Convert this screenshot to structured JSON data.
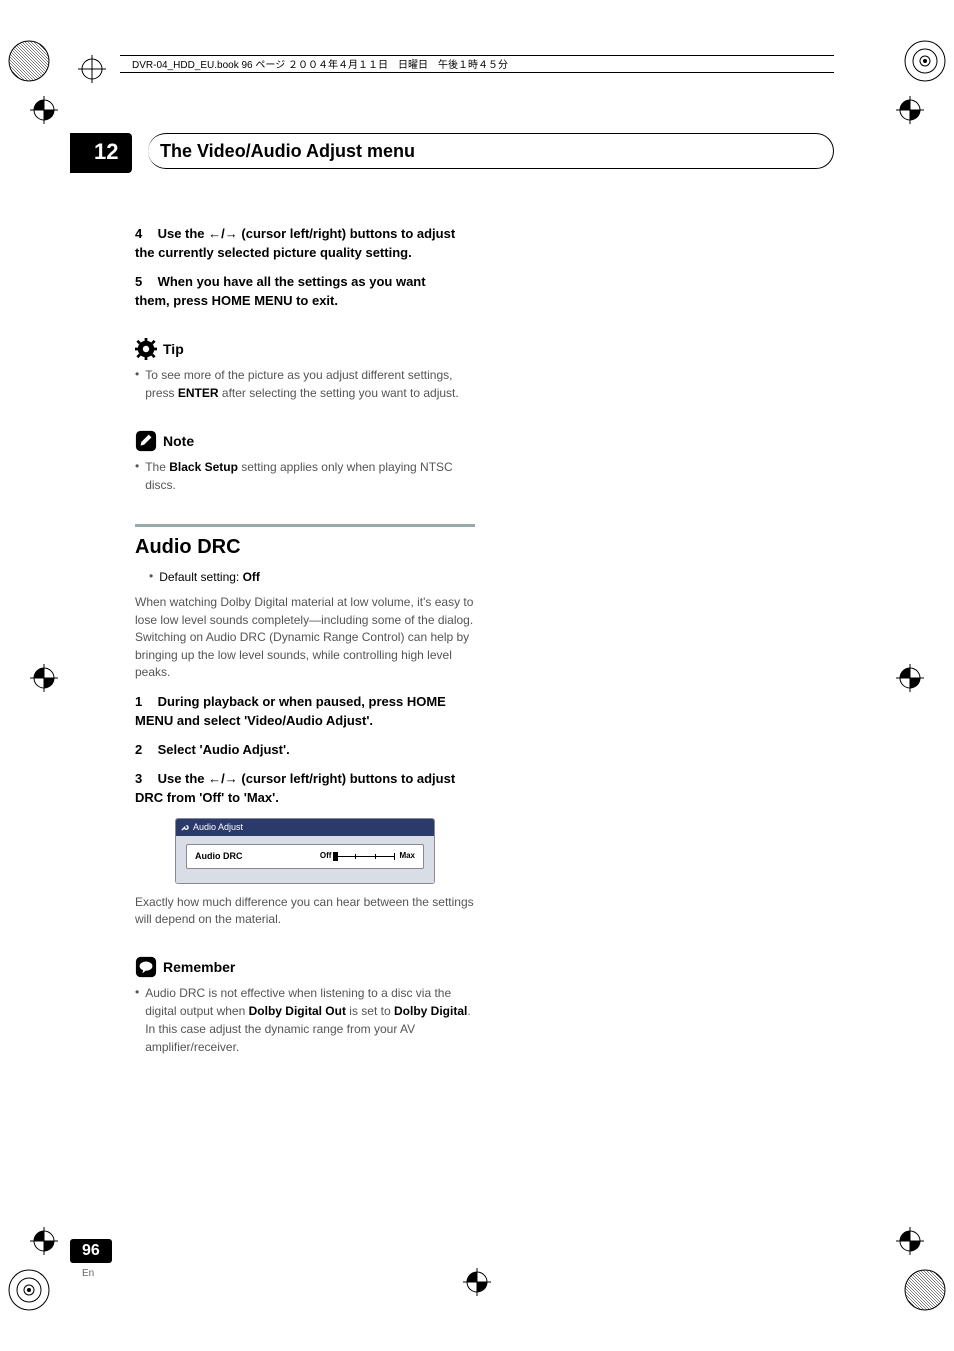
{
  "fileheader": "DVR-04_HDD_EU.book  96 ページ  ２００４年４月１１日　日曜日　午後１時４５分",
  "chapter": {
    "number": "12",
    "title": "The Video/Audio Adjust menu"
  },
  "step4": {
    "num": "4",
    "line1_a": "Use the ",
    "line1_arrows": "←/→",
    "line1_b": " (cursor left/right) buttons to adjust",
    "line2": "the currently selected picture quality setting."
  },
  "step5": {
    "num": "5",
    "line1": "When you have all the settings as you want",
    "line2": "them, press HOME MENU to exit."
  },
  "tip": {
    "label": "Tip",
    "bullet1_a": "To see more of the picture as you adjust different settings, press ",
    "bullet1_b": "ENTER",
    "bullet1_c": " after selecting the setting you want to adjust."
  },
  "note": {
    "label": "Note",
    "bullet1_a": "The ",
    "bullet1_b": "Black Setup",
    "bullet1_c": " setting applies only when playing NTSC discs."
  },
  "audiodrc": {
    "heading": "Audio DRC",
    "default_a": "Default setting: ",
    "default_b": "Off",
    "para": "When watching Dolby Digital material at low volume, it's easy to lose low level sounds completely—including some of the dialog. Switching on Audio DRC (Dynamic Range Control) can help by bringing up the low level sounds, while controlling high level peaks.",
    "step1": {
      "num": "1",
      "line1": "During playback or when paused, press HOME",
      "line2": "MENU and select 'Video/Audio Adjust'."
    },
    "step2": {
      "num": "2",
      "text": "Select 'Audio Adjust'."
    },
    "step3": {
      "num": "3",
      "line1_a": "Use the ",
      "line1_arrows": "←/→",
      "line1_b": " (cursor left/right) buttons to adjust",
      "line2": "DRC from 'Off' to 'Max'."
    },
    "panel": {
      "title": "Audio Adjust",
      "row_label": "Audio DRC",
      "off": "Off",
      "max": "Max"
    },
    "after_panel": "Exactly how much difference you can hear between the settings will depend on the material."
  },
  "remember": {
    "label": "Remember",
    "bullet1_a": "Audio DRC is not effective when listening to a disc via the digital output when ",
    "bullet1_b": "Dolby Digital Out",
    "bullet1_c": " is set to ",
    "bullet1_d": "Dolby Digital",
    "bullet1_e": ". In this case adjust the dynamic range from your AV amplifier/receiver."
  },
  "pagenum": "96",
  "pagelang": "En"
}
